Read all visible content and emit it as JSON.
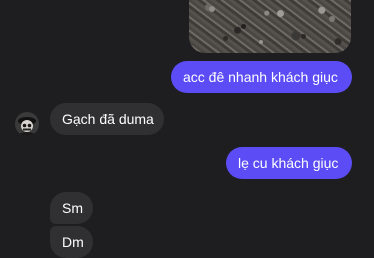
{
  "messages": [
    {
      "id": "out1",
      "direction": "outgoing",
      "text": "acc đê nhanh khách giục"
    },
    {
      "id": "in1",
      "direction": "incoming",
      "text": "Gạch đã duma"
    },
    {
      "id": "out2",
      "direction": "outgoing",
      "text": "lẹ cu khách giục"
    },
    {
      "id": "in2",
      "direction": "incoming",
      "text": "Sm"
    },
    {
      "id": "in3",
      "direction": "incoming",
      "text": "Dm"
    }
  ],
  "colors": {
    "background": "#1e1e20",
    "outgoing_bubble": "#5b4cf5",
    "incoming_bubble": "#303033",
    "text": "#ffffff"
  }
}
